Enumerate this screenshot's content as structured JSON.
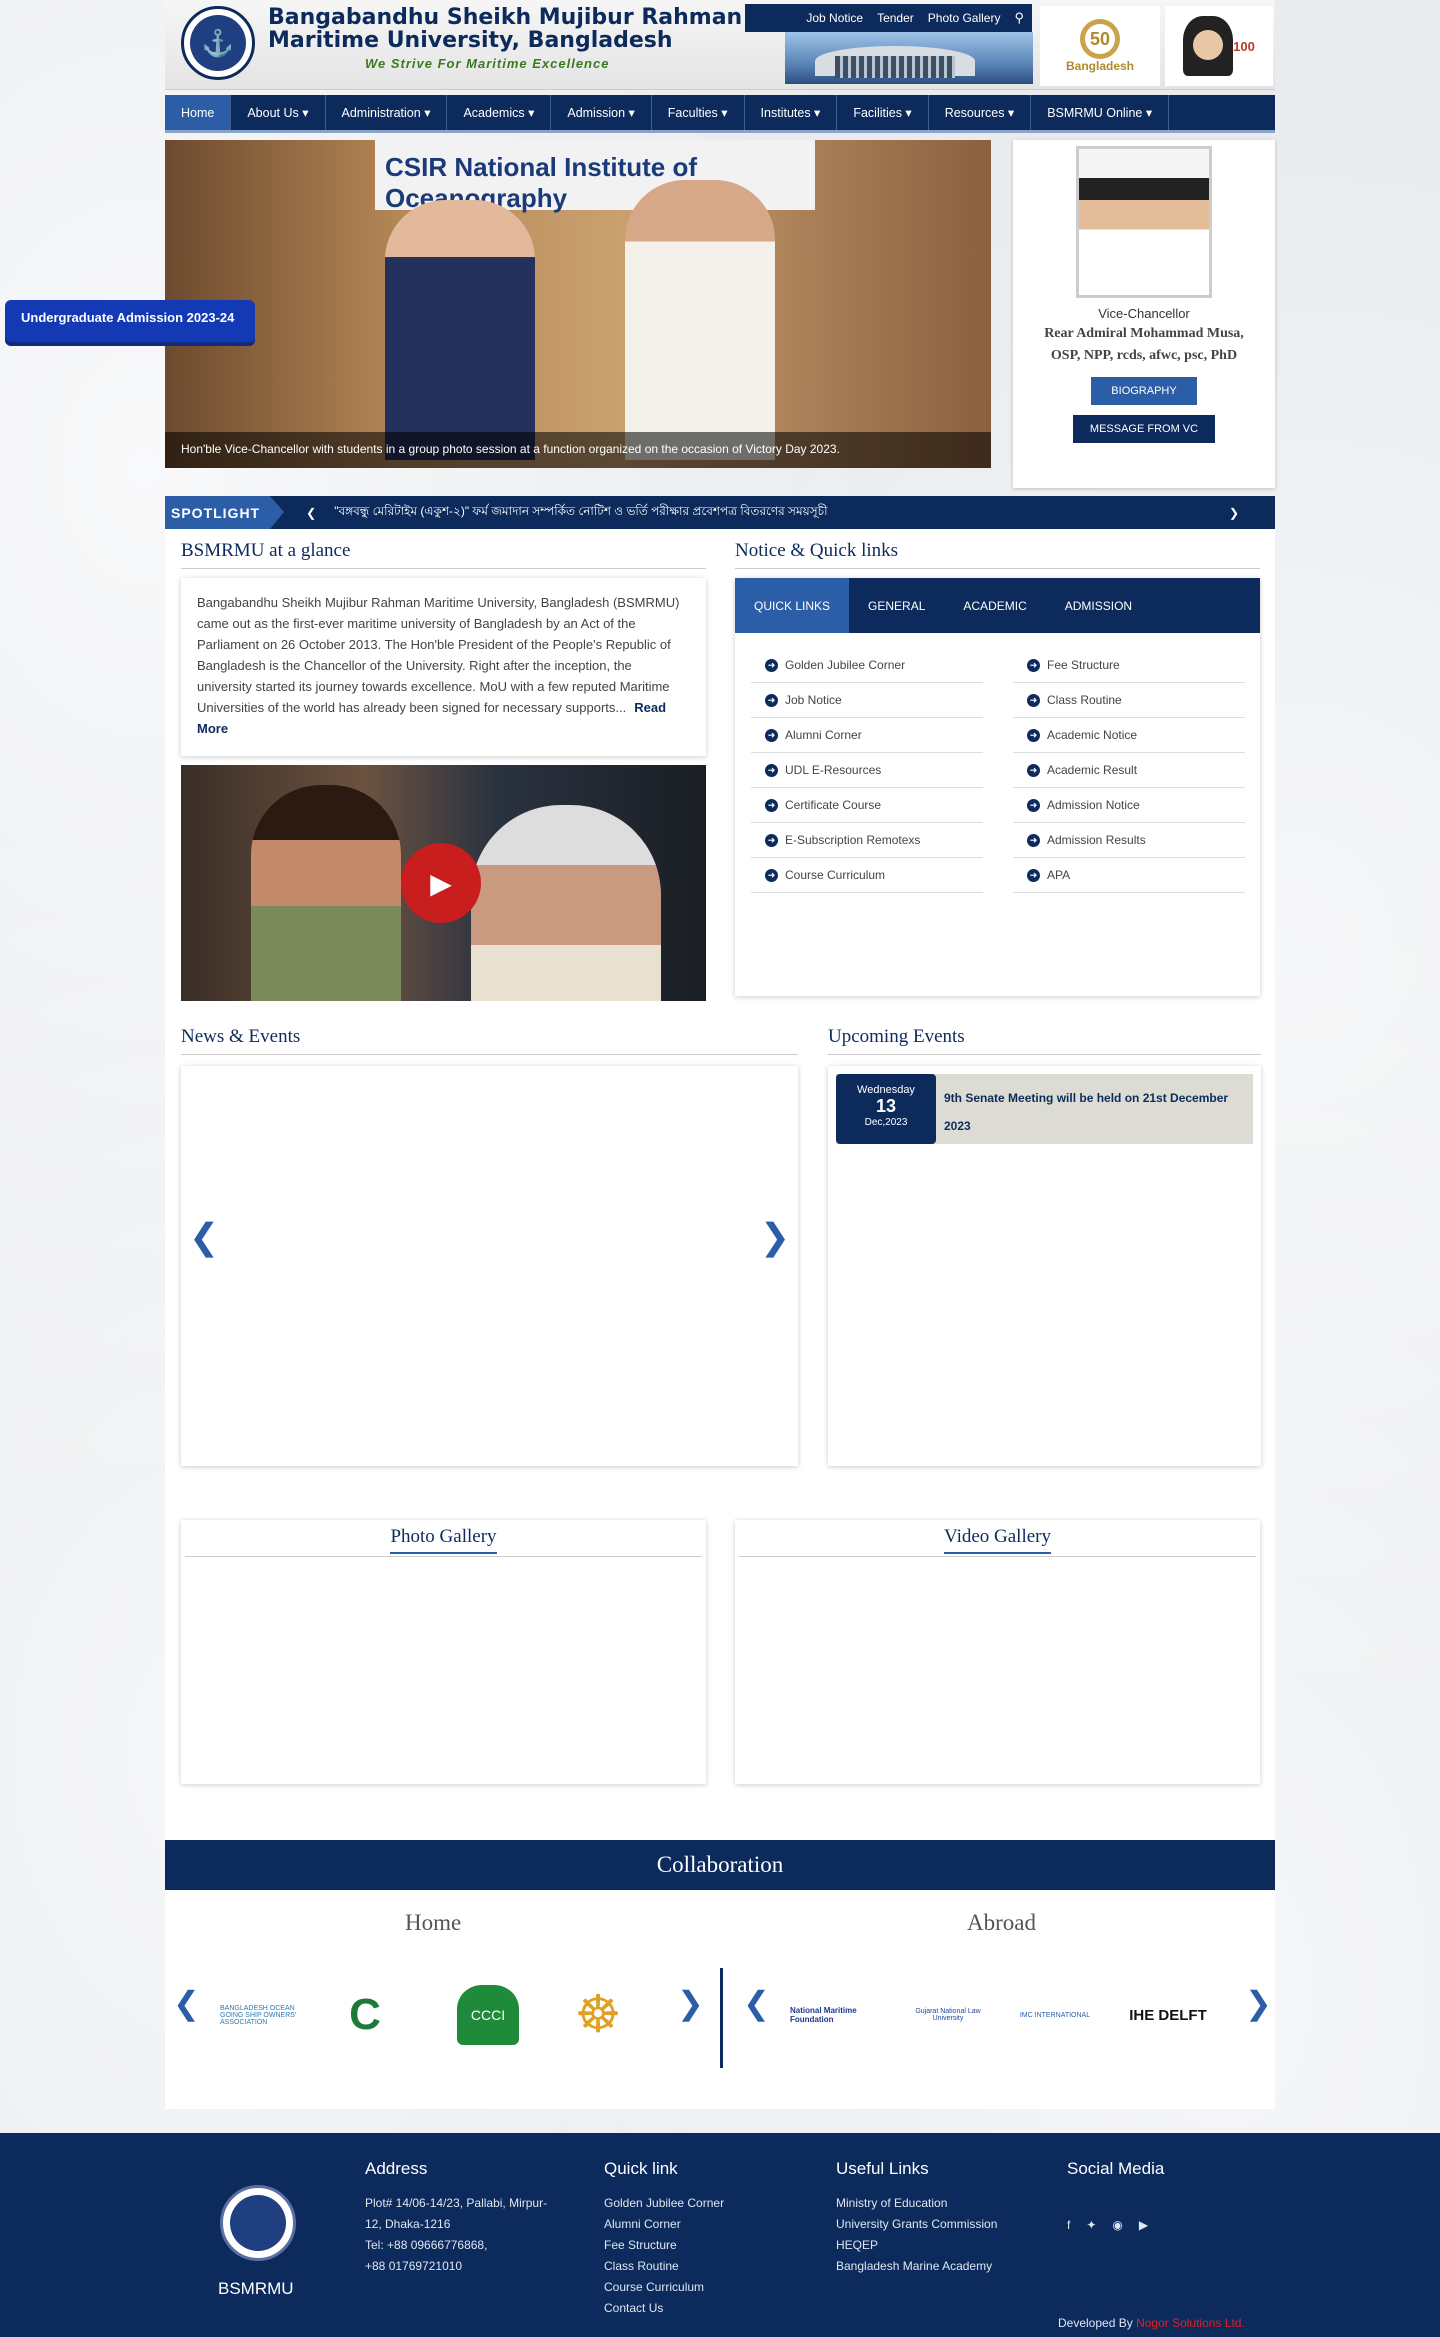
{
  "header": {
    "uni_line1": "Bangabandhu Sheikh Mujibur Rahman",
    "uni_line2": "Maritime University, Bangladesh",
    "motto": "We Strive For Maritime Excellence",
    "top_links": [
      "Job Notice",
      "Tender",
      "Photo Gallery"
    ],
    "badge_text": "Bangladesh",
    "badge_num": "50",
    "mujib_text": "100"
  },
  "nav": [
    "Home",
    "About Us ▾",
    "Administration ▾",
    "Academics ▾",
    "Admission ▾",
    "Faculties ▾",
    "Institutes ▾",
    "Facilities ▾",
    "Resources ▾",
    "BSMRMU Online ▾"
  ],
  "admission_tab": "Undergraduate Admission 2023-24",
  "slider": {
    "banner": "CSIR National Institute of Oceanography",
    "caption": "Hon'ble Vice-Chancellor with students in a group photo session at a function organized on the occasion of Victory Day 2023."
  },
  "vc": {
    "role": "Vice-Chancellor",
    "name": "Rear Admiral Mohammad Musa, OSP, NPP, rcds, afwc, psc, PhD",
    "bio": "BIOGRAPHY",
    "message": "MESSAGE FROM VC"
  },
  "spotlight": {
    "label": "SPOTLIGHT",
    "text": "\"বঙ্গবন্ধু মেরিটাইম (একুশ-২)\" ফর্ম জমাদান সম্পর্কিত নোটিশ ও ভর্তি পরীক্ষার প্রবেশপত্র বিতরণের সময়সূচী"
  },
  "glance": {
    "title": "BSMRMU at a glance",
    "text": "Bangabandhu Sheikh Mujibur Rahman Maritime University, Bangladesh (BSMRMU) came out as the first-ever maritime university of Bangladesh by an Act of the Parliament on 26 October 2013. The Hon'ble President of the People's Republic of Bangladesh is the Chancellor of the University. Right after the inception, the university started its journey towards excellence. MoU with a few reputed Maritime Universities of the world has already been signed for necessary supports...",
    "read_more": "Read More"
  },
  "notice": {
    "title": "Notice & Quick links",
    "tabs": [
      "QUICK LINKS",
      "GENERAL",
      "ACADEMIC",
      "ADMISSION"
    ],
    "left": [
      "Golden Jubilee Corner",
      "Job Notice",
      "Alumni Corner",
      "UDL E-Resources",
      "Certificate Course",
      "E-Subscription Remotexs",
      "Course Curriculum"
    ],
    "right": [
      "Fee Structure",
      "Class Routine",
      "Academic Notice",
      "Academic Result",
      "Admission Notice",
      "Admission Results",
      "APA"
    ]
  },
  "news": {
    "title": "News & Events"
  },
  "upcoming": {
    "title": "Upcoming Events",
    "day": "Wednesday",
    "date": "13",
    "month": "Dec,2023",
    "event": "9th Senate Meeting will be held on 21st December 2023"
  },
  "gallery": {
    "photo": "Photo Gallery",
    "video": "Video Gallery"
  },
  "collab": {
    "title": "Collaboration",
    "home": "Home",
    "abroad": "Abroad",
    "home_logos": [
      "BANGLADESH OCEAN GOING SHIP OWNERS' ASSOCIATION",
      "C",
      "CCCI",
      "☸"
    ],
    "abroad_logos": [
      "National Maritime Foundation",
      "Gujarat National Law University",
      "IMC INTERNATIONAL",
      "IHE DELFT"
    ]
  },
  "footer": {
    "name": "BSMRMU",
    "address": {
      "title": "Address",
      "lines": [
        "Plot# 14/06-14/23, Pallabi, Mirpur-",
        "12, Dhaka-1216",
        "Tel: +88 09666776868,",
        "+88 01769721010"
      ]
    },
    "quick": {
      "title": "Quick link",
      "items": [
        "Golden Jubilee Corner",
        "Alumni Corner",
        "Fee Structure",
        "Class Routine",
        "Course Curriculum",
        "Contact Us"
      ]
    },
    "useful": {
      "title": "Useful Links",
      "items": [
        "Ministry of Education",
        "University Grants Commission",
        "HEQEP",
        "Bangladesh Marine Academy"
      ]
    },
    "social": {
      "title": "Social Media"
    },
    "dev_prefix": "Developed By",
    "dev_name": "Nogor Solutions Ltd."
  }
}
